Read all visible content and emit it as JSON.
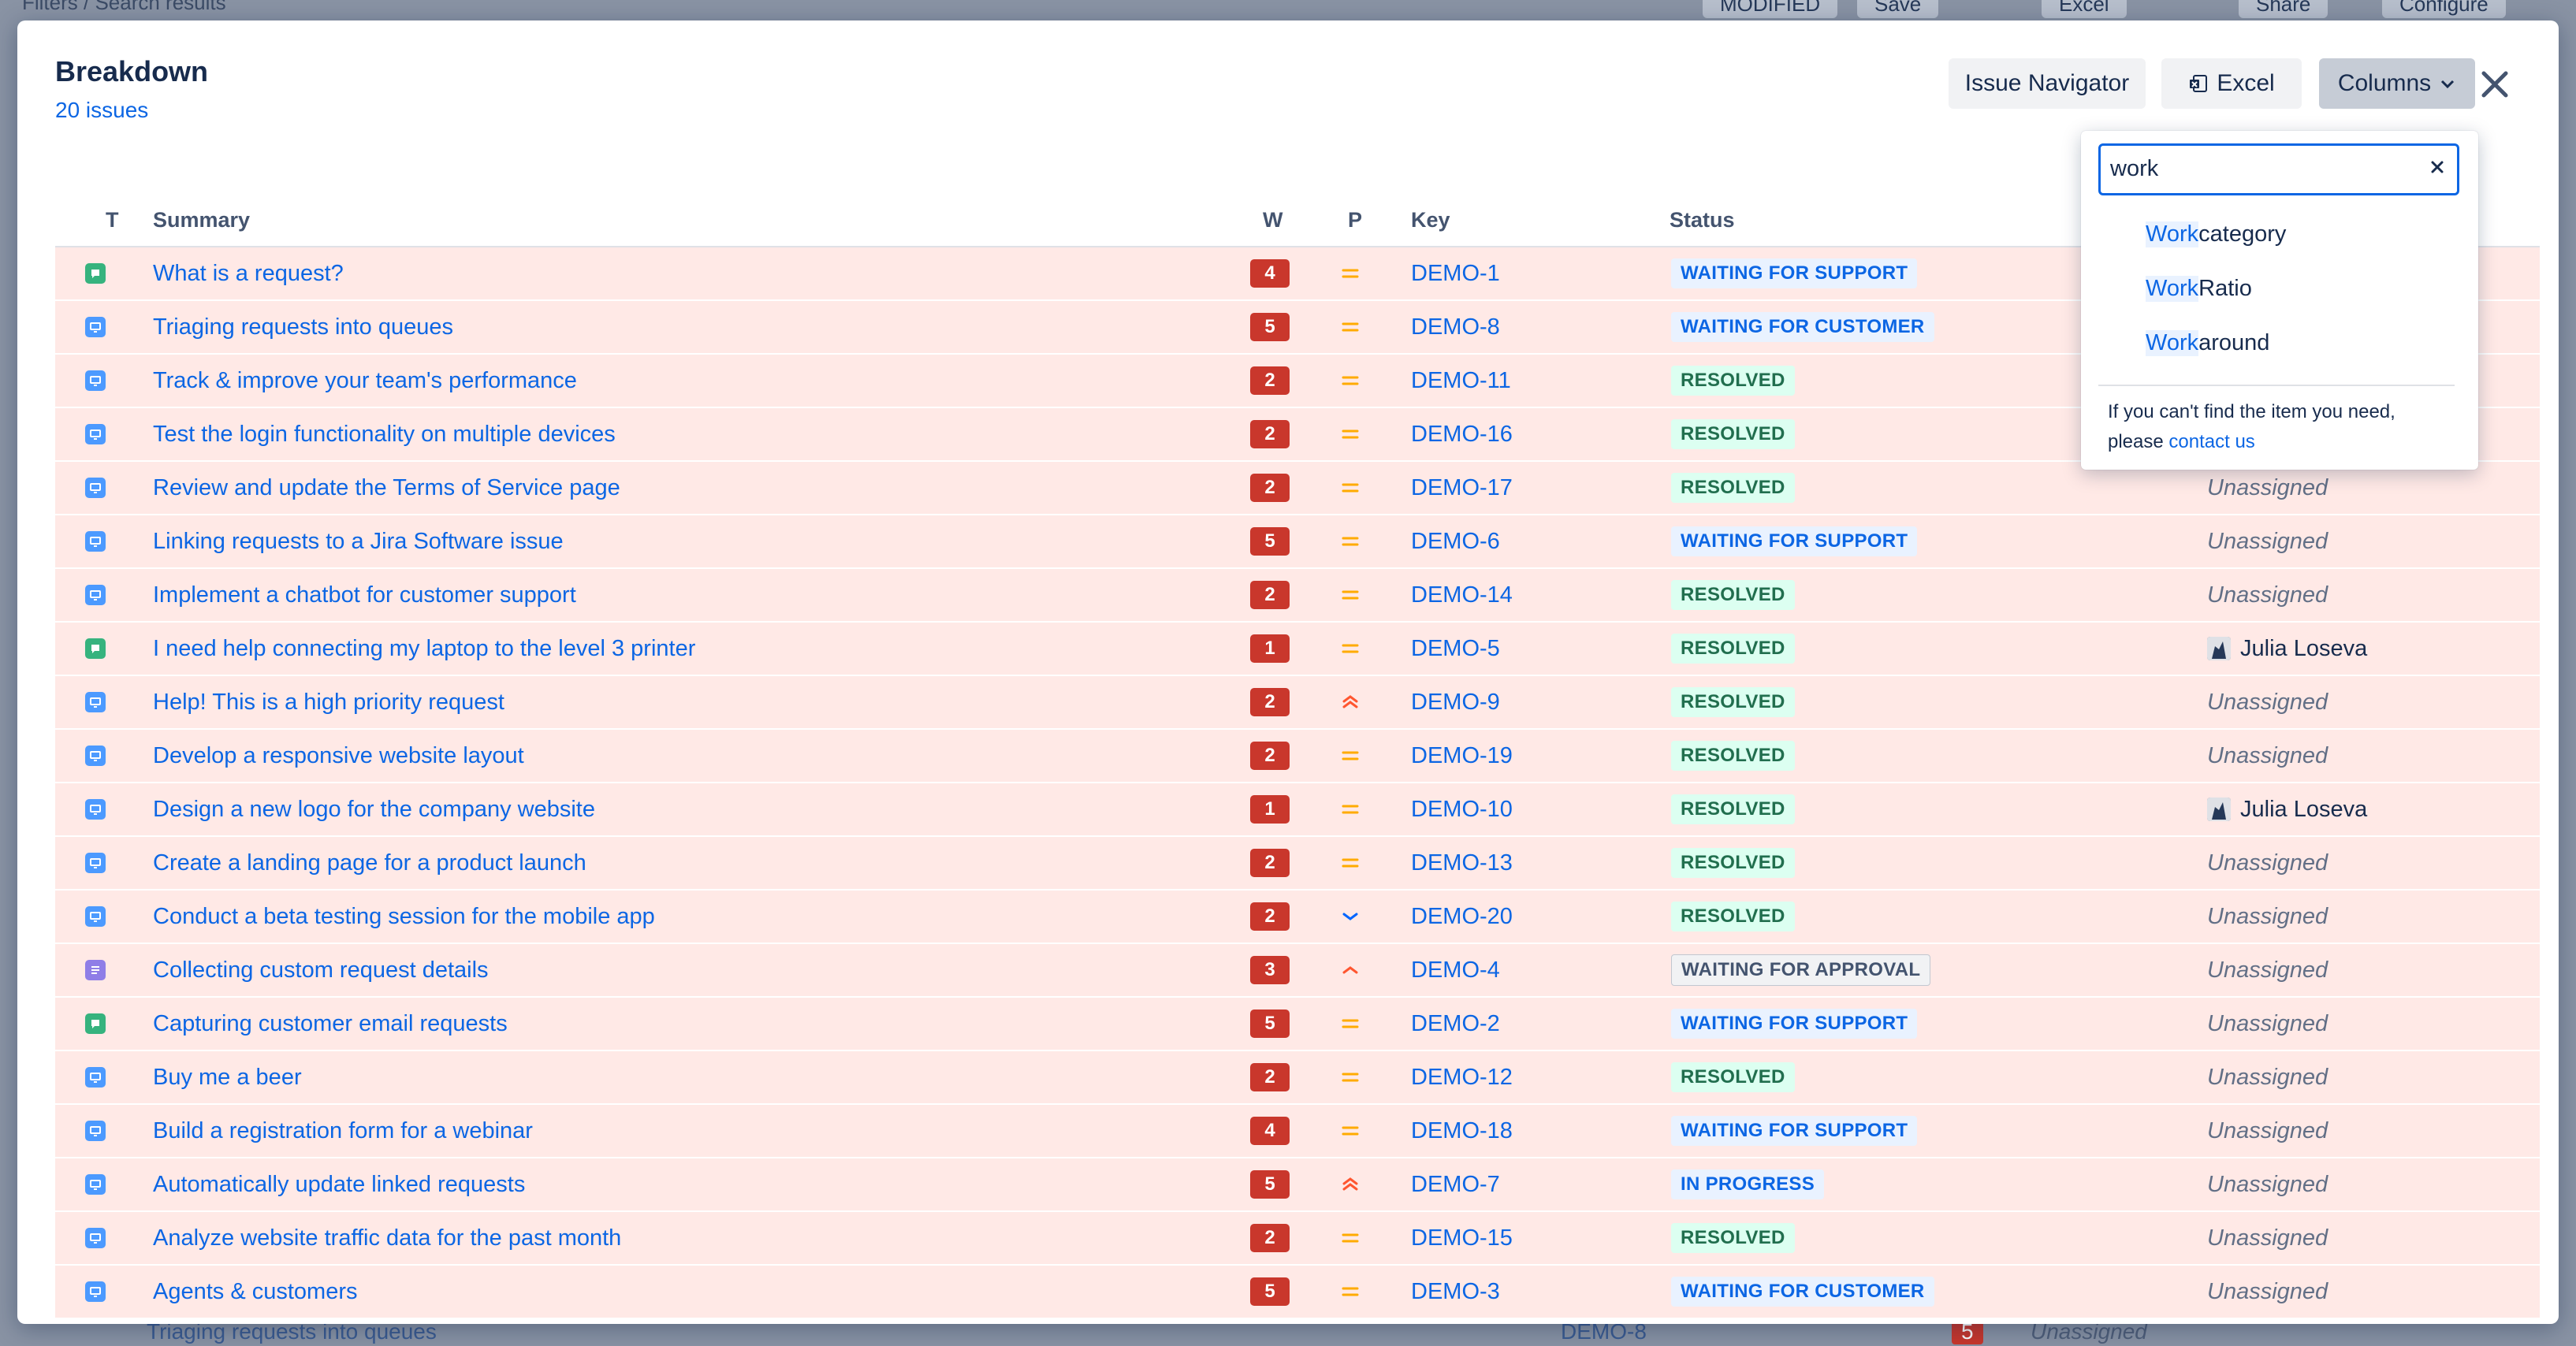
{
  "background": {
    "breadcrumb": "Filters / Search results",
    "modified_badge": "MODIFIED",
    "save_label": "Save",
    "excel_label": "Excel",
    "share_label": "Share",
    "configure_label": "Configure",
    "bottom_row": {
      "summary": "Triaging requests into queues",
      "key": "DEMO-8",
      "weight": "5",
      "assignee": "Unassigned"
    }
  },
  "modal": {
    "title": "Breakdown",
    "issue_count": "20 issues",
    "toolbar": {
      "issue_navigator_label": "Issue Navigator",
      "excel_label": "Excel",
      "columns_label": "Columns"
    }
  },
  "table": {
    "headers": {
      "t": "T",
      "summary": "Summary",
      "w": "W",
      "p": "P",
      "key": "Key",
      "status": "Status"
    },
    "rows": [
      {
        "type": "green",
        "summary": "What is a request?",
        "w": "4",
        "priority": "medium",
        "key": "DEMO-1",
        "status": "WAITING FOR SUPPORT",
        "status_color": "blue",
        "assignee": ""
      },
      {
        "type": "blue",
        "summary": "Triaging requests into queues",
        "w": "5",
        "priority": "medium",
        "key": "DEMO-8",
        "status": "WAITING FOR CUSTOMER",
        "status_color": "blue",
        "assignee": ""
      },
      {
        "type": "blue",
        "summary": "Track & improve your team's performance",
        "w": "2",
        "priority": "medium",
        "key": "DEMO-11",
        "status": "RESOLVED",
        "status_color": "green",
        "assignee": ""
      },
      {
        "type": "blue",
        "summary": "Test the login functionality on multiple devices",
        "w": "2",
        "priority": "medium",
        "key": "DEMO-16",
        "status": "RESOLVED",
        "status_color": "green",
        "assignee": ""
      },
      {
        "type": "blue",
        "summary": "Review and update the Terms of Service page",
        "w": "2",
        "priority": "medium",
        "key": "DEMO-17",
        "status": "RESOLVED",
        "status_color": "green",
        "assignee": "Unassigned"
      },
      {
        "type": "blue",
        "summary": "Linking requests to a Jira Software issue",
        "w": "5",
        "priority": "medium",
        "key": "DEMO-6",
        "status": "WAITING FOR SUPPORT",
        "status_color": "blue",
        "assignee": "Unassigned"
      },
      {
        "type": "blue",
        "summary": "Implement a chatbot for customer support",
        "w": "2",
        "priority": "medium",
        "key": "DEMO-14",
        "status": "RESOLVED",
        "status_color": "green",
        "assignee": "Unassigned"
      },
      {
        "type": "green",
        "summary": "I need help connecting my laptop to the level 3 printer",
        "w": "1",
        "priority": "medium",
        "key": "DEMO-5",
        "status": "RESOLVED",
        "status_color": "green",
        "assignee": "Julia Loseva"
      },
      {
        "type": "blue",
        "summary": "Help! This is a high priority request",
        "w": "2",
        "priority": "highest",
        "key": "DEMO-9",
        "status": "RESOLVED",
        "status_color": "green",
        "assignee": "Unassigned"
      },
      {
        "type": "blue",
        "summary": "Develop a responsive website layout",
        "w": "2",
        "priority": "medium",
        "key": "DEMO-19",
        "status": "RESOLVED",
        "status_color": "green",
        "assignee": "Unassigned"
      },
      {
        "type": "blue",
        "summary": "Design a new logo for the company website",
        "w": "1",
        "priority": "medium",
        "key": "DEMO-10",
        "status": "RESOLVED",
        "status_color": "green",
        "assignee": "Julia Loseva"
      },
      {
        "type": "blue",
        "summary": "Create a landing page for a product launch",
        "w": "2",
        "priority": "medium",
        "key": "DEMO-13",
        "status": "RESOLVED",
        "status_color": "green",
        "assignee": "Unassigned"
      },
      {
        "type": "blue",
        "summary": "Conduct a beta testing session for the mobile app",
        "w": "2",
        "priority": "low",
        "key": "DEMO-20",
        "status": "RESOLVED",
        "status_color": "green",
        "assignee": "Unassigned"
      },
      {
        "type": "purple",
        "summary": "Collecting custom request details",
        "w": "3",
        "priority": "high",
        "key": "DEMO-4",
        "status": "WAITING FOR APPROVAL",
        "status_color": "grey",
        "assignee": "Unassigned"
      },
      {
        "type": "green",
        "summary": "Capturing customer email requests",
        "w": "5",
        "priority": "medium",
        "key": "DEMO-2",
        "status": "WAITING FOR SUPPORT",
        "status_color": "blue",
        "assignee": "Unassigned"
      },
      {
        "type": "blue",
        "summary": "Buy me a beer",
        "w": "2",
        "priority": "medium",
        "key": "DEMO-12",
        "status": "RESOLVED",
        "status_color": "green",
        "assignee": "Unassigned"
      },
      {
        "type": "blue",
        "summary": "Build a registration form for a webinar",
        "w": "4",
        "priority": "medium",
        "key": "DEMO-18",
        "status": "WAITING FOR SUPPORT",
        "status_color": "blue",
        "assignee": "Unassigned"
      },
      {
        "type": "blue",
        "summary": "Automatically update linked requests",
        "w": "5",
        "priority": "highest",
        "key": "DEMO-7",
        "status": "IN PROGRESS",
        "status_color": "blue",
        "assignee": "Unassigned"
      },
      {
        "type": "blue",
        "summary": "Analyze website traffic data for the past month",
        "w": "2",
        "priority": "medium",
        "key": "DEMO-15",
        "status": "RESOLVED",
        "status_color": "green",
        "assignee": "Unassigned"
      },
      {
        "type": "blue",
        "summary": "Agents & customers",
        "w": "5",
        "priority": "medium",
        "key": "DEMO-3",
        "status": "WAITING FOR CUSTOMER",
        "status_color": "blue",
        "assignee": "Unassigned"
      }
    ]
  },
  "columns_dropdown": {
    "search_value": "work",
    "options": [
      {
        "match": "Work",
        "rest": " category"
      },
      {
        "match": "Work",
        "rest": " Ratio"
      },
      {
        "match": "Work",
        "rest": "around"
      }
    ],
    "help_text": "If you can't find the item you need, please ",
    "help_link": "contact us"
  },
  "colors": {
    "row_bg": "#ffe9e6",
    "link": "#0c66e4",
    "weight_badge": "#c9372c",
    "type_blue": "#4c9aff",
    "type_green": "#36b37e",
    "type_purple": "#8f7ee7",
    "priority_medium": "#ffab00",
    "priority_high": "#ff5630",
    "priority_low": "#0065ff"
  }
}
